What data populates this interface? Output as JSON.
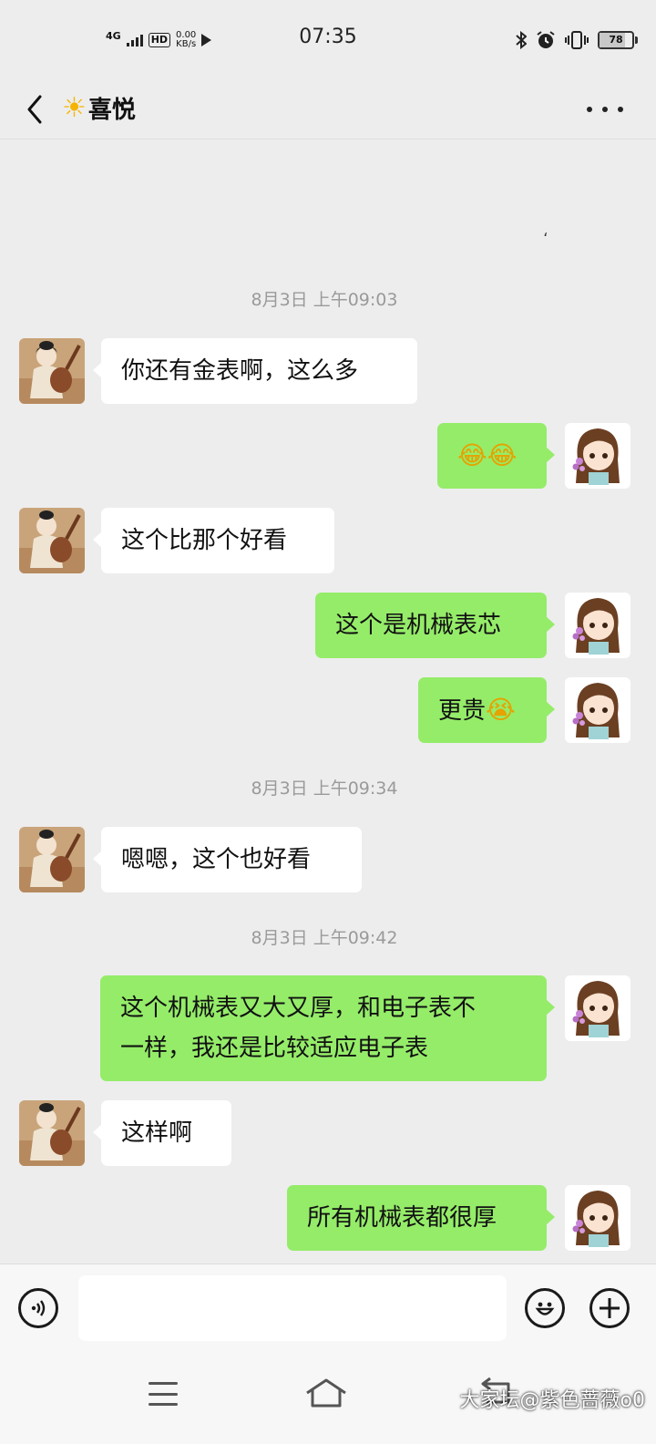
{
  "status_bar": {
    "network": "4G",
    "hd": "HD",
    "speed_value": "0.00",
    "speed_unit": "KB/s",
    "time": "07:35",
    "battery": "78",
    "battery_level": 0.78
  },
  "header": {
    "title": "喜悦",
    "title_icon": "sun-emoji-icon"
  },
  "stray_mark": "،",
  "messages": {
    "t1": "8月3日 上午09:03",
    "m1": "你还有金表啊，这么多",
    "m2": "😂😂",
    "m3": "这个比那个好看",
    "m4": "这个是机械表芯",
    "m5_text": "更贵",
    "m5_emoji": "😭",
    "t2": "8月3日 上午09:34",
    "m6": "嗯嗯，这个也好看",
    "t3": "8月3日 上午09:42",
    "m7_line1": "这个机械表又大又厚，和电子表不",
    "m7_line2": "一样，我还是比较适应电子表",
    "m8": "这样啊",
    "m9": "所有机械表都很厚"
  },
  "input": {
    "value": ""
  },
  "watermark": "大家坛@紫色蔷薇o0",
  "colors": {
    "background": "#ededed",
    "outgoing_bubble": "#95ec69",
    "incoming_bubble": "#ffffff",
    "timestamp": "#9a9a9a"
  }
}
